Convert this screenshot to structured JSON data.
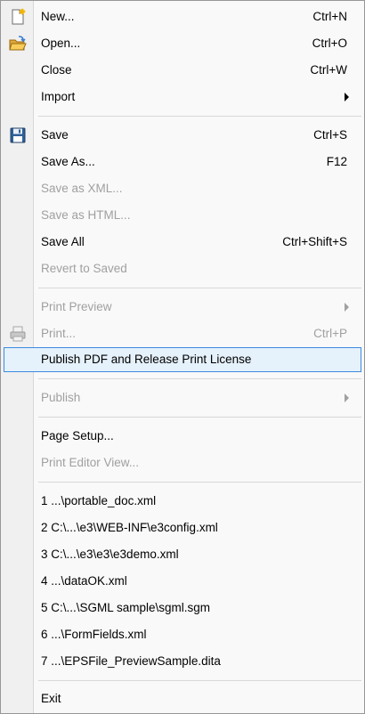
{
  "menu": {
    "items": [
      {
        "id": "new",
        "label": "New...",
        "shortcut": "Ctrl+N"
      },
      {
        "id": "open",
        "label": "Open...",
        "shortcut": "Ctrl+O"
      },
      {
        "id": "close",
        "label": "Close",
        "shortcut": "Ctrl+W"
      },
      {
        "id": "import",
        "label": "Import",
        "shortcut": ""
      },
      {
        "id": "save",
        "label": "Save",
        "shortcut": "Ctrl+S"
      },
      {
        "id": "save-as",
        "label": "Save As...",
        "shortcut": "F12"
      },
      {
        "id": "save-as-xml",
        "label": "Save as XML...",
        "shortcut": ""
      },
      {
        "id": "save-as-html",
        "label": "Save as HTML...",
        "shortcut": ""
      },
      {
        "id": "save-all",
        "label": "Save All",
        "shortcut": "Ctrl+Shift+S"
      },
      {
        "id": "revert",
        "label": "Revert to Saved",
        "shortcut": ""
      },
      {
        "id": "print-preview",
        "label": "Print Preview",
        "shortcut": ""
      },
      {
        "id": "print",
        "label": "Print...",
        "shortcut": "Ctrl+P"
      },
      {
        "id": "publish-pdf",
        "label": "Publish PDF and Release Print License",
        "shortcut": ""
      },
      {
        "id": "publish",
        "label": "Publish",
        "shortcut": ""
      },
      {
        "id": "page-setup",
        "label": "Page Setup...",
        "shortcut": ""
      },
      {
        "id": "print-editor-view",
        "label": "Print Editor View...",
        "shortcut": ""
      },
      {
        "id": "recent-1",
        "label": "1 ...\\portable_doc.xml",
        "shortcut": ""
      },
      {
        "id": "recent-2",
        "label": "2 C:\\...\\e3\\WEB-INF\\e3config.xml",
        "shortcut": ""
      },
      {
        "id": "recent-3",
        "label": "3 C:\\...\\e3\\e3\\e3demo.xml",
        "shortcut": ""
      },
      {
        "id": "recent-4",
        "label": "4 ...\\dataOK.xml",
        "shortcut": ""
      },
      {
        "id": "recent-5",
        "label": "5 C:\\...\\SGML sample\\sgml.sgm",
        "shortcut": ""
      },
      {
        "id": "recent-6",
        "label": "6 ...\\FormFields.xml",
        "shortcut": ""
      },
      {
        "id": "recent-7",
        "label": "7 ...\\EPSFile_PreviewSample.dita",
        "shortcut": ""
      },
      {
        "id": "exit",
        "label": "Exit",
        "shortcut": ""
      }
    ]
  },
  "icons": {
    "new": "new-document-icon",
    "open": "open-folder-icon",
    "save": "floppy-disk-icon",
    "print": "printer-icon"
  },
  "colors": {
    "highlight_bg": "#e5f1fb",
    "highlight_border": "#3c8be0",
    "disabled_text": "#a0a0a0"
  }
}
